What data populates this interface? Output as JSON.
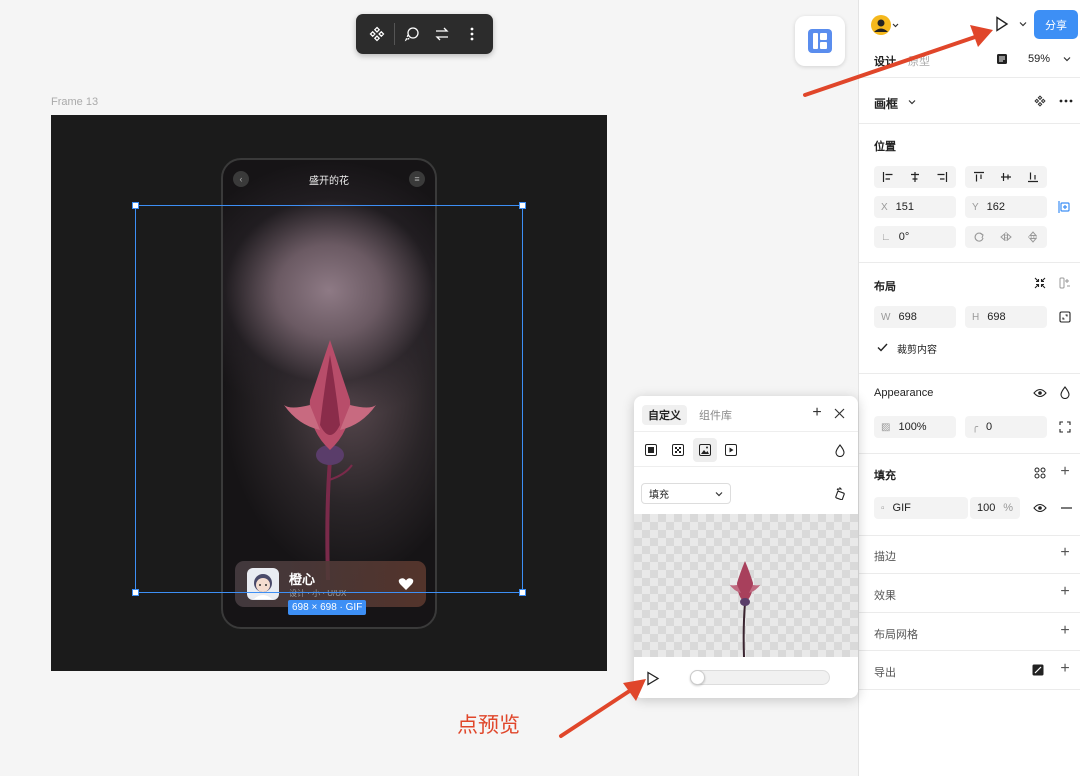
{
  "canvas": {
    "frame_label": "Frame 13",
    "size_badge": "698 × 698 · GIF",
    "annotation": "点预览"
  },
  "toolbar": {
    "tools": [
      "component-icon",
      "lasso-icon",
      "swap-icon",
      "more-vertical-icon"
    ]
  },
  "phone": {
    "title": "盛开的花",
    "card_name": "橙心",
    "card_sub": "设计 · 小 · U/UX"
  },
  "panel": {
    "tab_design": "设计",
    "tab_proto": "原型",
    "zoom": "59%",
    "share": "分享",
    "frame_label": "画框",
    "position": {
      "title": "位置",
      "x_label": "X",
      "x": "151",
      "y_label": "Y",
      "y": "162",
      "rotation": "0°"
    },
    "layout": {
      "title": "布局",
      "w_label": "W",
      "w": "698",
      "h_label": "H",
      "h": "698",
      "clip": "裁剪内容"
    },
    "appearance": {
      "title": "Appearance",
      "opacity": "100%",
      "radius": "0"
    },
    "fill": {
      "title": "填充",
      "type": "GIF",
      "opacity": "100",
      "pct": "%"
    },
    "stroke": "描边",
    "effects": "效果",
    "grid": "布局网格",
    "export": "导出"
  },
  "popup": {
    "tab_custom": "自定义",
    "tab_library": "组件库",
    "select": "填充",
    "progress": 0
  },
  "colors": {
    "accent": "#3d8ff5",
    "annotation": "#e0462a",
    "frame": "#1b1b1b"
  }
}
